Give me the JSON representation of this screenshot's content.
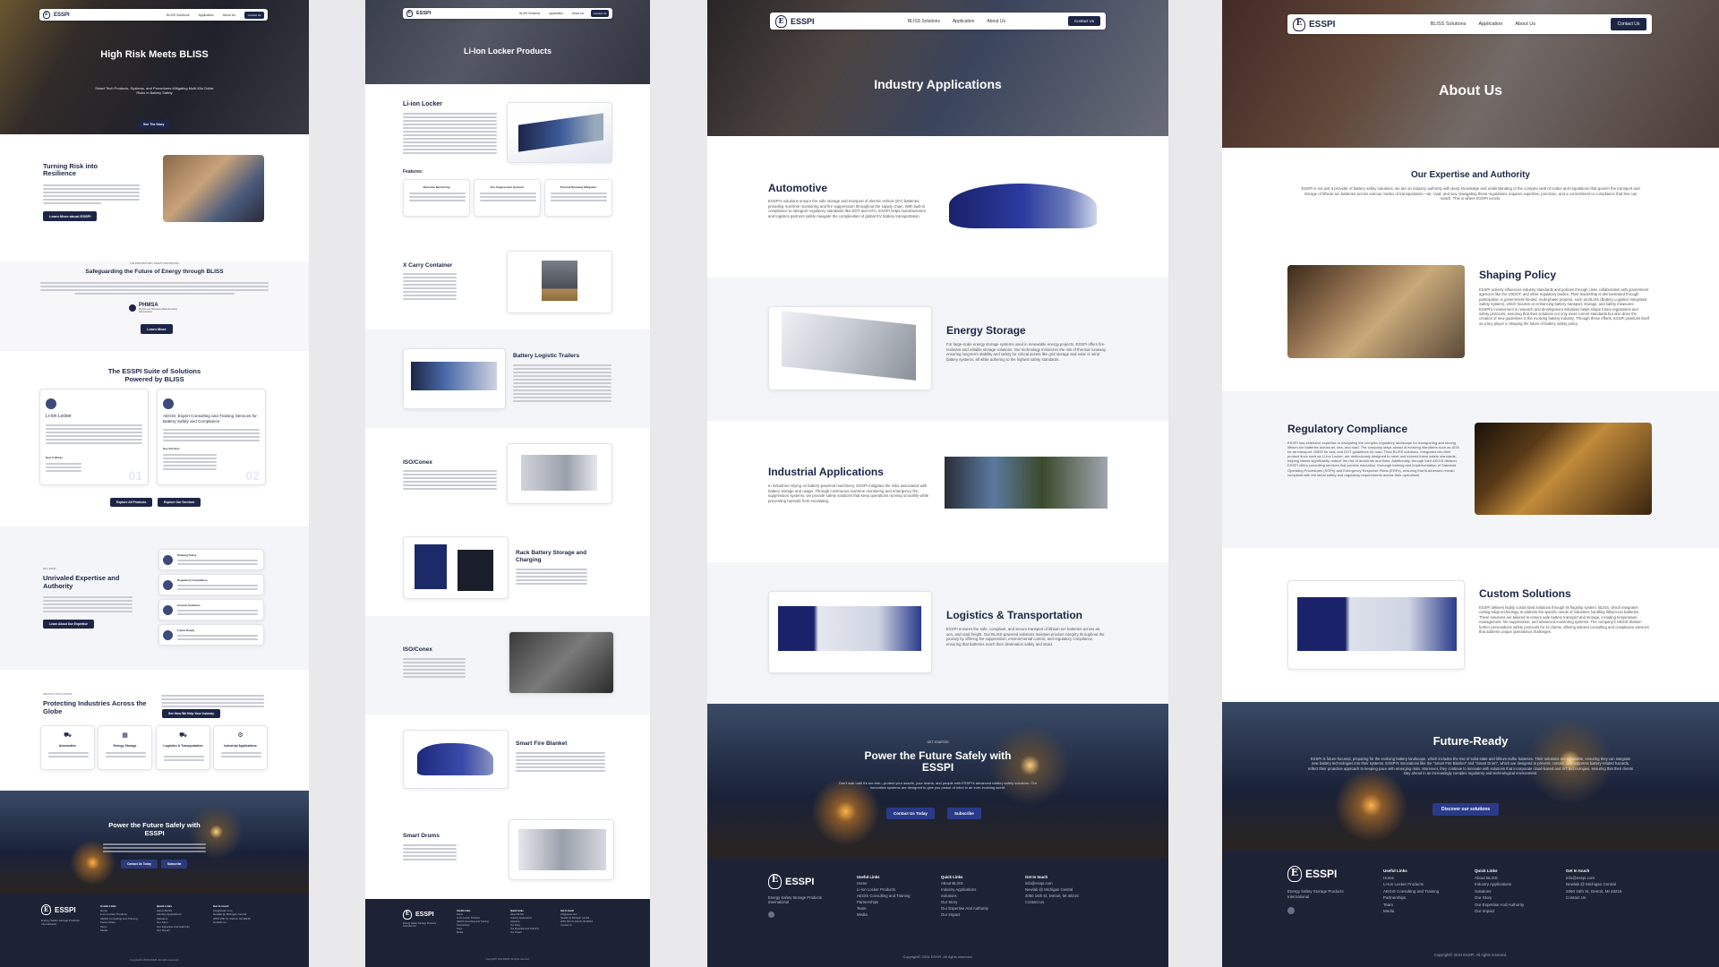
{
  "brand": {
    "name": "ESSPI",
    "tagline": "Energy Safety Storage Products International",
    "mark": "E"
  },
  "nav": {
    "items": [
      "BLISS Solutions",
      "Application",
      "About Us"
    ],
    "cta": "Contact Us"
  },
  "home": {
    "hero_title": "High Risk Meets BLISS",
    "hero_sub": "Smart Tech Products, Systems, and Procedures Mitigating Multi-Kilo Dollar Risks in Battery Safety",
    "hero_btn": "See The Story",
    "risk_title": "Turning Risk into Resilience",
    "risk_btn": "Learn More about ESSPI",
    "safeguard_kicker": "THE ESSPI BATTERY SAFETY INNOVATIONS",
    "safeguard_title": "Safeguarding the Future of Energy through BLISS",
    "phmsa": "PHMSA",
    "phmsa_sub": "Pipeline and Hazardous Materials Safety Administration",
    "learn_btn": "Learn More",
    "suite_title": "The ESSPI Suite of Solutions Powered by BLISS",
    "suite_cards": [
      {
        "title": "Li-Ion Locker",
        "num": "01",
        "sub": "How It Works"
      },
      {
        "title": "AEGIS: Expert Consulting and Training Services for Battery Safety and Compliance",
        "num": "02",
        "sub": "Key Services"
      }
    ],
    "suite_btns": [
      "Explore All Products",
      "Explore Our Services"
    ],
    "expertise_kicker": "WHY ESSPI",
    "expertise_title": "Unrivaled Expertise and Authority",
    "expertise_btn": "Learn About Our Expertise",
    "expertise_items": [
      "Shaping Policy",
      "Regulatory Compliance",
      "Custom Solutions",
      "Future Ready"
    ],
    "industries_kicker": "INDUSTRY APPLICATIONS",
    "industries_title": "Protecting Industries Across the Globe",
    "industries_btn": "See How We Help Your Industry",
    "industries": [
      "Automotive",
      "Energy Storage",
      "Logistics & Transportation",
      "Industrial Applications"
    ],
    "cta_title": "Power the Future Safely with ESSPI",
    "cta_btns": [
      "Contact Us Today",
      "Subscribe"
    ]
  },
  "products": {
    "hero_title": "Li-Ion Locker Products",
    "items": [
      "Li-ion Locker",
      "X Carry Container",
      "Battery Logistic Trailers",
      "ISO/Conex",
      "Rack Battery Storage and Charging",
      "ISO/Conex",
      "Smart Fire Blanket",
      "Smart Drums"
    ],
    "features_label": "Features:",
    "features": [
      "Real-time Monitoring",
      "Fire Suppression Systems",
      "Thermal Runaway Mitigation"
    ]
  },
  "applications": {
    "hero_title": "Industry Applications",
    "sections": [
      {
        "title": "Automotive",
        "body": "ESSPI's solutions ensure the safe storage and transport of electric vehicle (EV) batteries, providing real-time monitoring and fire suppression throughout the supply chain. With built-in compliance to stringent regulatory standards like DOT and IATA, ESSPI helps manufacturers and logistics partners safely navigate the complexities of global EV battery transportation."
      },
      {
        "title": "Energy Storage",
        "body": "For large-scale energy storage systems used in renewable energy projects, ESSPI offers fire-resistant and reliable storage solutions. Our technology minimizes the risk of thermal runaway, ensuring long-term stability and safety for critical assets like grid storage and solar or wind battery systems, all while adhering to the highest safety standards."
      },
      {
        "title": "Industrial Applications",
        "body": "In industries relying on battery-powered machinery, ESSPI mitigates the risks associated with battery storage and usage. Through continuous real-time monitoring and emergency fire suppression systems, we provide safety solutions that keep operations running smoothly while preventing hazards from escalating."
      },
      {
        "title": "Logistics & Transportation",
        "body": "ESSPI ensures the safe, compliant, and secure transport of lithium-ion batteries across air, sea, and road freight. Our BLISS-powered solutions maintain product integrity throughout the journey by offering fire suppression, environmental control, and regulatory compliance, ensuring that batteries reach their destination safely and intact."
      }
    ],
    "cta_kicker": "GET STARTED",
    "cta_title": "Power the Future Safely with ESSPI",
    "cta_body": "Don't wait until it's too late—protect your assets, your teams, and people with ESSPI's advanced battery safety solutions. Our innovative systems are designed to give you peace of mind in an ever-evolving world.",
    "cta_btns": [
      "Contact Us Today",
      "Subscribe"
    ]
  },
  "about": {
    "hero_title": "About Us",
    "expertise_title": "Our Expertise and Authority",
    "expertise_body": "ESSPI is not just a provider of battery safety solutions; we are an industry authority with deep knowledge and understanding of the complex web of codes and regulations that govern the transport and storage of lithium-ion batteries across various modes of transportation—air, road, and sea. Navigating these regulations requires expertise, precision, and a commitment to compliance that few can match. This is where ESSPI excels.",
    "sections": [
      {
        "title": "Shaping Policy",
        "body": "ESSPI actively influences industry standards and policies through close collaboration with government agencies like the USDOT, and other regulatory bodies. Their leadership is demonstrated through participation in government-funded, multi-phase projects, such as BLISS (Battery Logistics Integrated Safety System), which focuses on enhancing battery transport, storage, and safety measures. ESSPI's involvement in research and development initiatives helps shape future regulations and safety protocols, ensuring that their solutions not only meet current standards but also drive the creation of new guidelines in the evolving battery industry. Through these efforts, ESSPI positions itself as a key player in shaping the future of battery safety policy."
      },
      {
        "title": "Regulatory Compliance",
        "body": "ESSPI has extensive expertise in navigating the complex regulatory landscape for transporting and storing lithium-ion batteries across air, sea, and road. The company stays ahead of evolving standards such as IATA for air transport, IMDG for sea, and DOT guidelines for road. Their BLISS solutions, integrated into their product lines such as Li-Ion Locker, are meticulously designed to meet and exceed these safety standards, helping clients significantly reduce the risk of accidents and fines. Additionally, through their AEGIS division, ESSPI offers consulting services that provide education, thorough training and implementation of Standard Operating Procedures (SOPs) and Emergency Response Plans (ERPs), ensuring that businesses remain compliant with the latest safety and regulatory requirements across their operations."
      },
      {
        "title": "Custom Solutions",
        "body": "ESSPI delivers highly customized solutions through its flagship system, BLISS, which integrates cutting-edge technology to address the specific needs of industries handling lithium-ion batteries. These solutions are tailored to ensure safe battery transport and storage, including temperature management, fire suppression, and advanced monitoring systems. The company's AEGIS division further personalizes safety protocols for its clients, offering tailored consulting and compliance services that address unique operational challenges."
      }
    ],
    "future_title": "Future-Ready",
    "future_body": "ESSPI is future-focused, preparing for the evolving battery landscape, which includes the rise of solid-state and lithium-sulfur batteries. Their solutions are adaptable, ensuring they can integrate new battery technologies into their systems. ESSPI's innovations like the \"Smart Fire Blanket\" and \"Smart Drum\", which are designed to prevent, contain, and suppress battery-related hazards, reflect their proactive approach to keeping pace with emerging risks. Moreover, they continue to innovate with solutions that incorporate cloud-based and IoT technologies, ensuring that their clients stay ahead in an increasingly complex regulatory and technological environment.",
    "future_btn": "Discover our solutions"
  },
  "footer": {
    "useful_links_title": "Useful Links",
    "useful_links": [
      "Home",
      "Li-Ion Locker Products",
      "AEGIS Consulting and Training",
      "Partnerships",
      "Team",
      "Media"
    ],
    "quick_links_title": "Quick Links",
    "quick_links": [
      "About BLISS",
      "Industry Applications",
      "Solutions",
      "Our Story",
      "Our Expertise And Authority",
      "Our Impact"
    ],
    "contact_title": "Get In touch",
    "contact": [
      "info@esspi.com",
      "Newlab @ Michigan Central",
      "2050 15th St, Detroit, MI 48216",
      "Contact Us"
    ],
    "copyright": "Copyright© 2024 ESSPI. All rights reserved."
  },
  "colors": {
    "navy": "#1c2546",
    "footer": "#1e2235",
    "accent_blue": "#1e3a8a"
  }
}
